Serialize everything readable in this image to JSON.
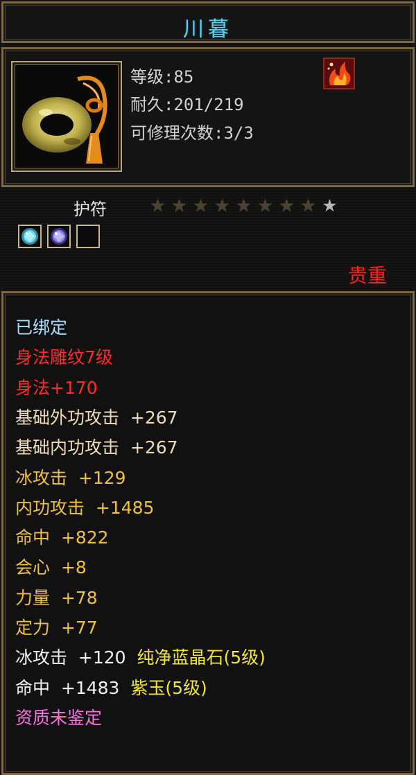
{
  "item": {
    "name": "川暮",
    "level_label": "等级:85",
    "durability_label": "耐久:201/219",
    "repair_label": "可修理次数:3/3",
    "type": "护符",
    "rarity": "贵重",
    "stars_total": 9,
    "stars_dim": 8,
    "gem_slots": [
      "cyan-gem",
      "purple-gem",
      "empty-slot"
    ]
  },
  "stats": [
    {
      "text": "已绑定",
      "color": "#a8e0ff"
    },
    {
      "text": "身法雕纹7级",
      "color": "#ff2a2a"
    },
    {
      "text": "身法+170",
      "color": "#ff2a2a"
    },
    {
      "text": "基础外功攻击  +267",
      "color": "#f0dcb4"
    },
    {
      "text": "基础内功攻击  +267",
      "color": "#f0dcb4"
    },
    {
      "text": "冰攻击  +129",
      "color": "#f0c040"
    },
    {
      "text": "内功攻击  +1485",
      "color": "#f0c040"
    },
    {
      "text": "命中  +822",
      "color": "#f0c040"
    },
    {
      "text": "会心  +8",
      "color": "#f0c040"
    },
    {
      "text": "力量  +78",
      "color": "#f0c040"
    },
    {
      "text": "定力  +77",
      "color": "#f0c040"
    },
    {
      "text": "冰攻击  +120  纯净蓝晶石(5级)",
      "color": "#f2f2f2",
      "accent_color": "#f3e530"
    },
    {
      "text": "命中  +1483  紫玉(5级)",
      "color": "#f2f2f2",
      "accent_color": "#f3e530"
    },
    {
      "text": "资质未鉴定",
      "color": "#ff70e0"
    }
  ]
}
